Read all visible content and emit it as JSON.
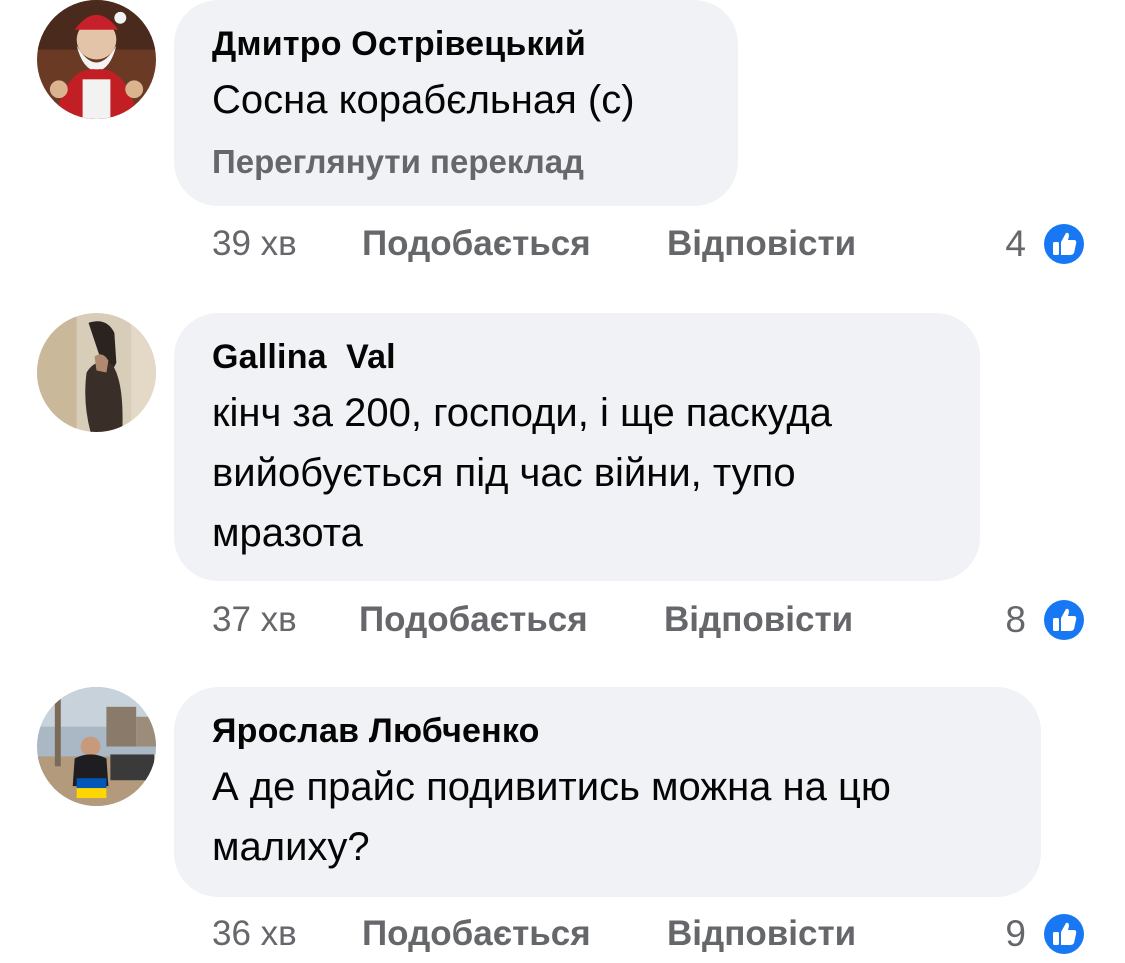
{
  "comments": [
    {
      "author": "Дмитро Острівецький",
      "text": "Сосна корабєльная (с)",
      "translate_link": "Переглянути переклад",
      "time": "39 хв",
      "like_label": "Подобається",
      "reply_label": "Відповісти",
      "reactions_count": "4",
      "reaction_icon": "like-icon"
    },
    {
      "author": "Gallina  Val",
      "text_lines": [
        "кінч за 200, господи, і ще паскуда",
        "вийобується під час війни, тупо",
        "мразота"
      ],
      "time": "37 хв",
      "like_label": "Подобається",
      "reply_label": "Відповісти",
      "reactions_count": "8",
      "reaction_icon": "like-icon"
    },
    {
      "author": "Ярослав Любченко",
      "text_lines": [
        "А де прайс подивитись можна на цю",
        "малиху?"
      ],
      "time": "36 хв",
      "like_label": "Подобається",
      "reply_label": "Відповісти",
      "reactions_count": "9",
      "reaction_icon": "like-icon"
    }
  ],
  "colors": {
    "bubble_bg": "#f0f2f5",
    "meta_text": "#65676b",
    "like_blue": "#1877f2"
  }
}
